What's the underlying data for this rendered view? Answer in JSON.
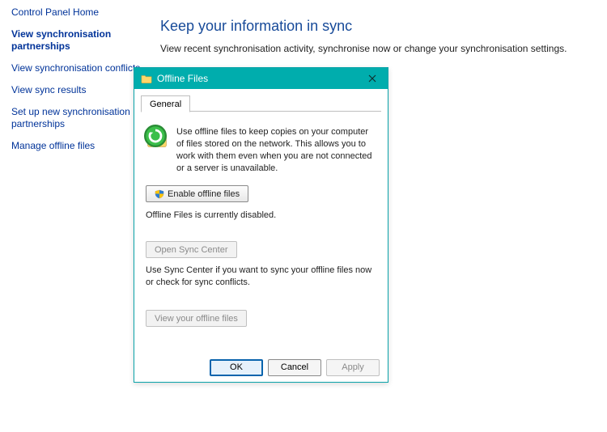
{
  "sidebar": {
    "items": [
      {
        "label": "Control Panel Home"
      },
      {
        "label": "View synchronisation partnerships"
      },
      {
        "label": "View synchronisation conflicts"
      },
      {
        "label": "View sync results"
      },
      {
        "label": "Set up new synchronisation partnerships"
      },
      {
        "label": "Manage offline files"
      }
    ]
  },
  "main": {
    "title": "Keep your information in sync",
    "subtitle": "View recent synchronisation activity, synchronise now or change your synchronisation settings."
  },
  "dialog": {
    "title": "Offline Files",
    "tab": "General",
    "description": "Use offline files to keep copies on your computer of files stored on the network. This allows you to work with them even when you are not connected or a server is unavailable.",
    "enable_button": "Enable offline files",
    "status": "Offline Files is currently disabled.",
    "open_sync_button": "Open Sync Center",
    "sync_desc": "Use Sync Center if you want to sync your offline files now or check for sync conflicts.",
    "view_files_button": "View your offline files",
    "footer": {
      "ok": "OK",
      "cancel": "Cancel",
      "apply": "Apply"
    }
  }
}
